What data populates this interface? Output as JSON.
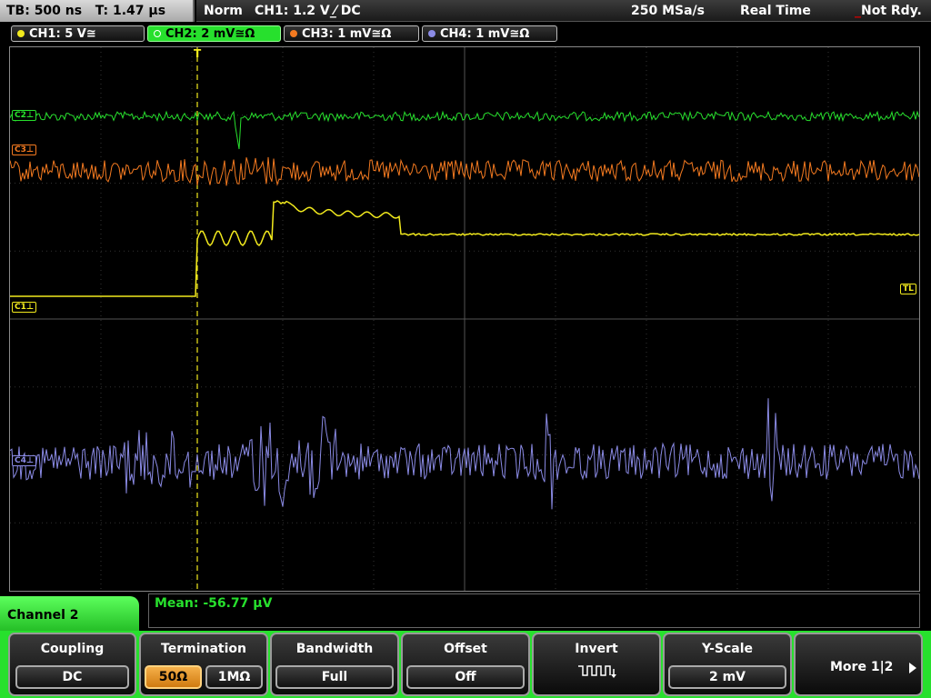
{
  "timebase": {
    "tb_label": "TB: 500 ns",
    "t_label": "T: 1.47 µs"
  },
  "status": {
    "mode": "Norm",
    "trigger": "CH1: 1.2 V ⁄̲ DC",
    "sample_rate": "250 MSa/s",
    "realtime": "Real Time",
    "ready": "Not Rdy."
  },
  "channels": [
    {
      "label": "CH1: 5 V≅",
      "color": "#f2ea1d"
    },
    {
      "label": "CH2: 2 mV≅Ω",
      "color": "#27e02d"
    },
    {
      "label": "CH3: 1 mV≅Ω",
      "color": "#f47a20"
    },
    {
      "label": "CH4: 1 mV≅Ω",
      "color": "#8b8be6"
    }
  ],
  "markers": {
    "c2": "C2⊥",
    "c3": "C3⊥",
    "c1": "C1⊥",
    "c4": "C4⊥",
    "tl": "TL",
    "trigger_t": "T"
  },
  "measurement": {
    "label": "Mean: -56.77 µV"
  },
  "menu": {
    "title": "Channel 2",
    "coupling": {
      "title": "Coupling",
      "value": "DC"
    },
    "termination": {
      "title": "Termination",
      "options": [
        "50Ω",
        "1MΩ"
      ],
      "selected": "50Ω"
    },
    "bandwidth": {
      "title": "Bandwidth",
      "value": "Full"
    },
    "offset": {
      "title": "Offset",
      "value": "Off"
    },
    "invert": {
      "title": "Invert",
      "icon": "invert-square-wave-icon"
    },
    "yscale": {
      "title": "Y-Scale",
      "value": "2 mV"
    },
    "more": {
      "label": "More 1|2",
      "icon": "arrow-right-icon"
    }
  }
}
